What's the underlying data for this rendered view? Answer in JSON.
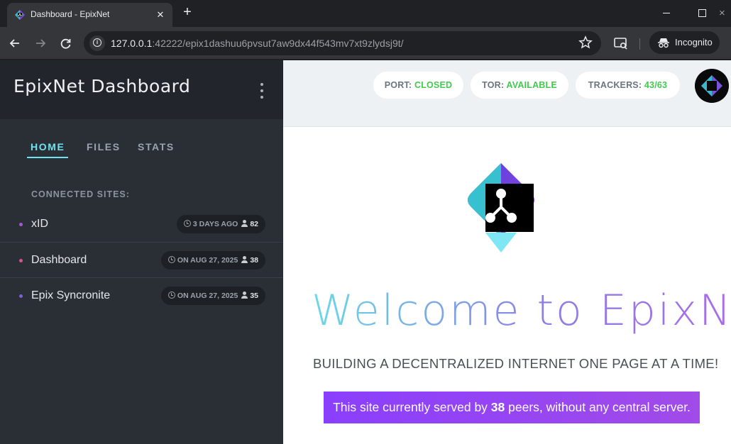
{
  "browser": {
    "tab_title": "Dashboard - EpixNet",
    "tab_close": "✕",
    "new_tab": "+",
    "url_host": "127.0.0.1",
    "url_rest": ":42222/epix1dashuu6pvsut7aw9dx44f543mv7xt9zlydsj9t/",
    "incognito_label": "Incognito"
  },
  "sidebar": {
    "title": "EpixNet Dashboard",
    "tabs": [
      {
        "label": "HOME",
        "active": true
      },
      {
        "label": "FILES",
        "active": false
      },
      {
        "label": "STATS",
        "active": false
      }
    ],
    "section_label": "CONNECTED SITES:",
    "sites": [
      {
        "name": "xID",
        "time": "3 DAYS AGO",
        "peers": "82",
        "dot_color": "#b04fd8"
      },
      {
        "name": "Dashboard",
        "time": "ON AUG 27, 2025",
        "peers": "38",
        "dot_color": "#e0508c"
      },
      {
        "name": "Epix Syncronite",
        "time": "ON AUG 27, 2025",
        "peers": "35",
        "dot_color": "#7a5fe0"
      }
    ]
  },
  "status": {
    "port_label": "PORT:",
    "port_value": "CLOSED",
    "tor_label": "TOR:",
    "tor_value": "AVAILABLE",
    "trackers_label": "TRACKERS:",
    "trackers_value": "43/63"
  },
  "main": {
    "welcome": "Welcome to EpixNet",
    "tagline": "BUILDING A DECENTRALIZED INTERNET ONE PAGE AT A TIME!",
    "served_prefix": "This site currently served by ",
    "served_count": "38",
    "served_suffix": " peers, without any central server."
  },
  "colors": {
    "accent_cyan": "#6ee3ef",
    "status_green": "#43c94f",
    "banner_purple": "#8a3ffc"
  }
}
